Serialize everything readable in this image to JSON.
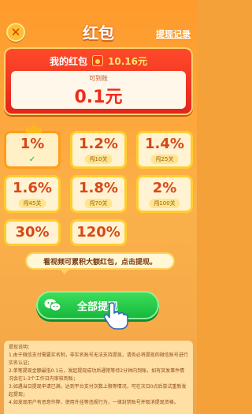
{
  "header": {
    "title": "红包",
    "records_link": "提现记录"
  },
  "card": {
    "label": "我的红包",
    "amount": "10.16元",
    "sub": "可到账",
    "value": "0.1元"
  },
  "options": [
    {
      "pct": "1%",
      "tag": "✓",
      "selected": true
    },
    {
      "pct": "1.2%",
      "tag": "闯10关"
    },
    {
      "pct": "1.4%",
      "tag": "闯25关"
    },
    {
      "pct": "1.6%",
      "tag": "闯45关"
    },
    {
      "pct": "1.8%",
      "tag": "闯70关"
    },
    {
      "pct": "2%",
      "tag": "闯100关"
    },
    {
      "pct": "30%",
      "tag": ""
    },
    {
      "pct": "120%",
      "tag": ""
    }
  ],
  "tip": "看视频可累积大额红包，点击提现。",
  "withdraw_label": "全部提现",
  "notes": {
    "title": "提现说明：",
    "lines": [
      "1.由于微信支付需要实名制，非实名账号无法支持提现，请务必将提现的微信账号进行实名认证；",
      "2.单笔提现金额最低0.1元，发起提现成功后通常等待2分钟内到账，如有突发事件情况会在1-3个工作日内审核到账；",
      "3.如遇当日提现申请已满，达到平台支付次数上限等情况，可在次日0点后尝试重新发起提现；",
      "4.如发现用户有恶意作弊、使用外挂等违规行为，一律封禁账号并取消提现资格。"
    ]
  },
  "colors": {
    "background": "#f4a13a",
    "card_red": "#e4241c",
    "button_green": "#17b83d",
    "option_border": "#ffce2e"
  }
}
